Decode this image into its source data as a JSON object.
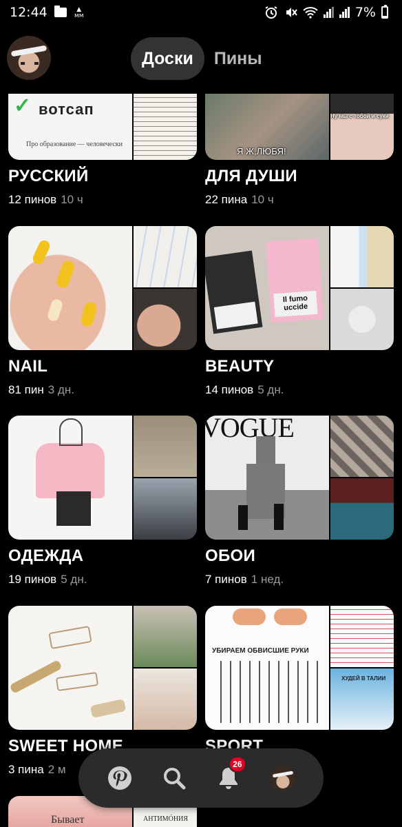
{
  "status_bar": {
    "time": "12:44",
    "battery": "7%",
    "icons": [
      "folder-icon",
      "mm-icon",
      "alarm-icon",
      "mute-icon",
      "wifi-icon",
      "signal-icon",
      "signal-icon",
      "battery-icon"
    ]
  },
  "header": {
    "tabs": [
      {
        "label": "Доски",
        "active": true
      },
      {
        "label": "Пины",
        "active": false
      }
    ]
  },
  "boards": [
    {
      "title": "РУССКИЙ",
      "pins": "12 пинов",
      "age": "10 ч",
      "cover_text": "вотсап",
      "cover_sub": "Про образование — человечески"
    },
    {
      "title": "ДЛЯ ДУШИ",
      "pins": "22 пина",
      "age": "10 ч",
      "cover_caption": "Я Ж,ЛЮБЯ!",
      "cover_caption_2": "Ну мы с тобой и суки"
    },
    {
      "title": "NAIL",
      "pins": "81 пин",
      "age": "3 дн."
    },
    {
      "title": "BEAUTY",
      "pins": "14 пинов",
      "age": "5 дн.",
      "cover_caption": "Il fumo uccide"
    },
    {
      "title": "ОДЕЖДА",
      "pins": "19 пинов",
      "age": "5 дн."
    },
    {
      "title": "ОБОИ",
      "pins": "7 пинов",
      "age": "1 нед.",
      "cover_caption": "VOGUE"
    },
    {
      "title": "SWEET HOME",
      "pins": "3 пина",
      "age": "2 м"
    },
    {
      "title": "SPORT",
      "pins": "",
      "age": "",
      "cover_caption": "УБИРАЕМ ОБВИСШИЕ РУКИ",
      "cover_caption_2": "ХУДЕЙ В ТАЛИИ"
    },
    {
      "title": "",
      "pins": "",
      "age": "",
      "cover_caption": "Бывает",
      "cover_caption_2": "АНТИМÓНИЯ"
    }
  ],
  "bottom_nav": {
    "items": [
      "pinterest-icon",
      "search-icon",
      "notifications-icon",
      "profile-avatar"
    ],
    "notification_count": "26"
  },
  "colors": {
    "background": "#000000",
    "accent": "#e60023",
    "tab_active_bg": "#333333",
    "nav_bg": "#2b2b2b"
  }
}
